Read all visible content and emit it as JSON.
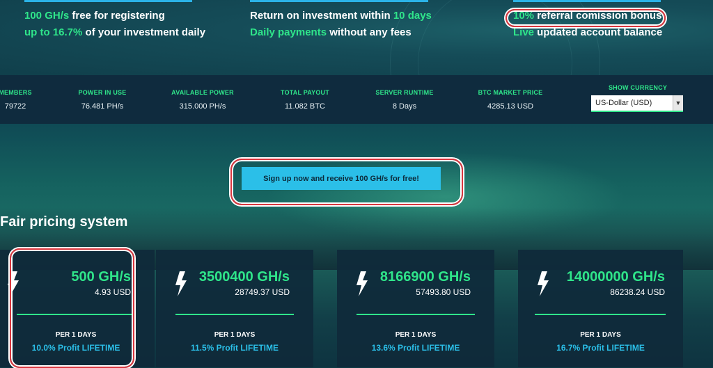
{
  "features": {
    "col1": {
      "line1_highlight": "100 GH/s",
      "line1_text": " free for registering",
      "line2_highlight": "up to 16.7%",
      "line2_text": " of your investment daily"
    },
    "col2": {
      "line1_text": "Return on investment within ",
      "line1_highlight": "10 days",
      "line2_highlight": "Daily payments",
      "line2_text": " without any fees"
    },
    "col3": {
      "line1_highlight": "10%",
      "line1_text": " referral comission bonus",
      "line2_highlight": "Live",
      "line2_text": " updated account balance"
    }
  },
  "stats": [
    {
      "label": "MEMBERS",
      "value": "79722"
    },
    {
      "label": "POWER IN USE",
      "value": "76.481 PH/s"
    },
    {
      "label": "AVAILABLE POWER",
      "value": "315.000 PH/s"
    },
    {
      "label": "TOTAL PAYOUT",
      "value": "11.082 BTC"
    },
    {
      "label": "SERVER RUNTIME",
      "value": "8 Days"
    },
    {
      "label": "BTC MARKET PRICE",
      "value": "4285.13 USD"
    }
  ],
  "currency": {
    "label": "SHOW CURRENCY",
    "selected": "US-Dollar (USD)"
  },
  "cta_label": "Sign up now and receive 100 GH/s for free!",
  "section_title": "Fair pricing system",
  "plans": [
    {
      "power": "500 GH/s",
      "price": "4.93 USD",
      "period": "PER 1 DAYS",
      "profit": "10.0% Profit LIFETIME"
    },
    {
      "power": "3500400 GH/s",
      "price": "28749.37 USD",
      "period": "PER 1 DAYS",
      "profit": "11.5% Profit LIFETIME"
    },
    {
      "power": "8166900 GH/s",
      "price": "57493.80 USD",
      "period": "PER 1 DAYS",
      "profit": "13.6% Profit LIFETIME"
    },
    {
      "power": "14000000 GH/s",
      "price": "86238.24 USD",
      "period": "PER 1 DAYS",
      "profit": "16.7% Profit LIFETIME"
    }
  ],
  "colors": {
    "accent_green": "#2fe58a",
    "accent_blue": "#2bbfe8",
    "highlight_red": "#d9363e",
    "panel": "#0f2b3e"
  }
}
